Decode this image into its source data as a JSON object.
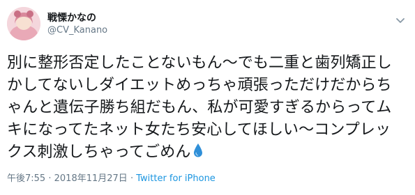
{
  "user": {
    "display_name": "戦慄かなの",
    "handle": "@CV_Kanano"
  },
  "tweet": {
    "lines": [
      "別に整形否定したことないもん〜でも二重と歯列矯正し",
      "かしてないしダイエットめっちゃ頑張っただけだからち",
      "ゃんと遺伝子勝ち組だもん、私が可愛すぎるからってム",
      "キになってたネット女たち安心してほしい〜コンプレッ",
      "クス刺激しちゃってごめん"
    ],
    "emoji_icon": "droplet-icon"
  },
  "meta": {
    "time": "午後7:55",
    "separator": "·",
    "date": "2018年11月27日",
    "via": "Twitter for iPhone"
  },
  "colors": {
    "text": "#14171a",
    "muted": "#657786",
    "link": "#1b95e0",
    "droplet": "#2f8fd8"
  }
}
